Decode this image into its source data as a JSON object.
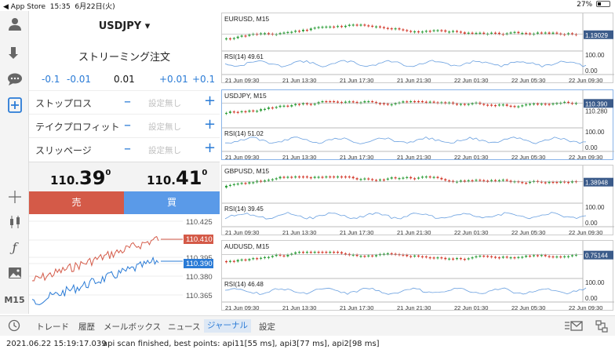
{
  "status_bar": {
    "back_label": "◀ App Store",
    "time": "15:35",
    "date": "6月22日(火)",
    "battery": "27%"
  },
  "order_panel": {
    "symbol": "USDJPY ▾",
    "order_type": "ストリーミング注文",
    "lot_buttons": [
      "-0.1",
      "-0.01",
      "0.01",
      "+0.01",
      "+0.1"
    ],
    "rows": [
      {
        "label": "ストップロス",
        "value": "設定無し"
      },
      {
        "label": "テイクプロフィット",
        "value": "設定無し"
      },
      {
        "label": "スリッページ",
        "value": "設定無し"
      }
    ],
    "bid": {
      "small": "110.",
      "big": "39",
      "sup": "0"
    },
    "ask": {
      "small": "110.",
      "big": "41",
      "sup": "0"
    },
    "sell_label": "売",
    "buy_label": "買"
  },
  "tick_chart": {
    "levels": [
      "110.425",
      "110.410",
      "110.395",
      "110.390",
      "110.380",
      "110.365"
    ],
    "ask_tag": "110.410",
    "bid_tag": "110.390",
    "colors": {
      "ask": "#d45a48",
      "bid": "#2a7bd6"
    }
  },
  "left_toolbar": {
    "icons": [
      "user-icon",
      "download-icon",
      "chat-icon",
      "new-order-icon",
      "crosshair-icon",
      "candlestick-icon",
      "function-icon",
      "image-icon"
    ],
    "timeframe": "M15"
  },
  "charts": [
    {
      "title": "EURUSD, M15",
      "price_tag": "1.19029",
      "price_axis": [
        "",
        "1.19029"
      ],
      "rsi_label": "RSI(14) 49.61",
      "rsi_axis": [
        "100.00",
        "0.00"
      ],
      "time_labels": [
        "21 Jun 09:30",
        "21 Jun 13:30",
        "21 Jun 17:30",
        "21 Jun 21:30",
        "22 Jun 01:30",
        "22 Jun 05:30",
        "22 Jun 09:30"
      ]
    },
    {
      "title": "USDJPY, M15",
      "price_tag": "110.390",
      "price_axis": [
        "110.390",
        "110.280"
      ],
      "rsi_label": "RSI(14) 51.02",
      "rsi_axis": [
        "100.00",
        "0.00"
      ],
      "time_labels": [
        "21 Jun 09:30",
        "21 Jun 13:30",
        "21 Jun 17:30",
        "21 Jun 21:30",
        "22 Jun 01:30",
        "22 Jun 05:30",
        "22 Jun 09:30"
      ]
    },
    {
      "title": "GBPUSD, M15",
      "price_tag": "1.38948",
      "price_axis": [
        "1.38948",
        ""
      ],
      "rsi_label": "RSI(14) 39.45",
      "rsi_axis": [
        "100.00",
        "0.00"
      ],
      "time_labels": [
        "21 Jun 09:30",
        "21 Jun 13:30",
        "21 Jun 17:30",
        "21 Jun 21:30",
        "22 Jun 01:30",
        "22 Jun 05:30",
        "22 Jun 09:30"
      ]
    },
    {
      "title": "AUDUSD, M15",
      "price_tag": "0.75144",
      "price_axis": [
        "0.75144",
        ""
      ],
      "rsi_label": "RSI(14) 46.48",
      "rsi_axis": [
        "100.00",
        "0.00"
      ],
      "time_labels": [
        "21 Jun 09:30",
        "21 Jun 13:30",
        "21 Jun 17:30",
        "21 Jun 21:30",
        "22 Jun 01:30",
        "22 Jun 05:30",
        "22 Jun 09:30"
      ]
    }
  ],
  "chart_colors": {
    "up": "#2e9e3a",
    "down": "#d33a2c",
    "rsi": "#6aa0e0",
    "tag": "#3b5b8a"
  },
  "tab_bar": {
    "tabs": [
      "トレード",
      "履歴",
      "メールボックス",
      "ニュース",
      "ジャーナル",
      "設定"
    ],
    "active_tab": "ジャーナル"
  },
  "log": {
    "timestamp": "2021.06.22 15:19:17.039",
    "message": "api scan finished, best points: api11[55 ms], api3[77 ms], api2[98 ms]"
  }
}
